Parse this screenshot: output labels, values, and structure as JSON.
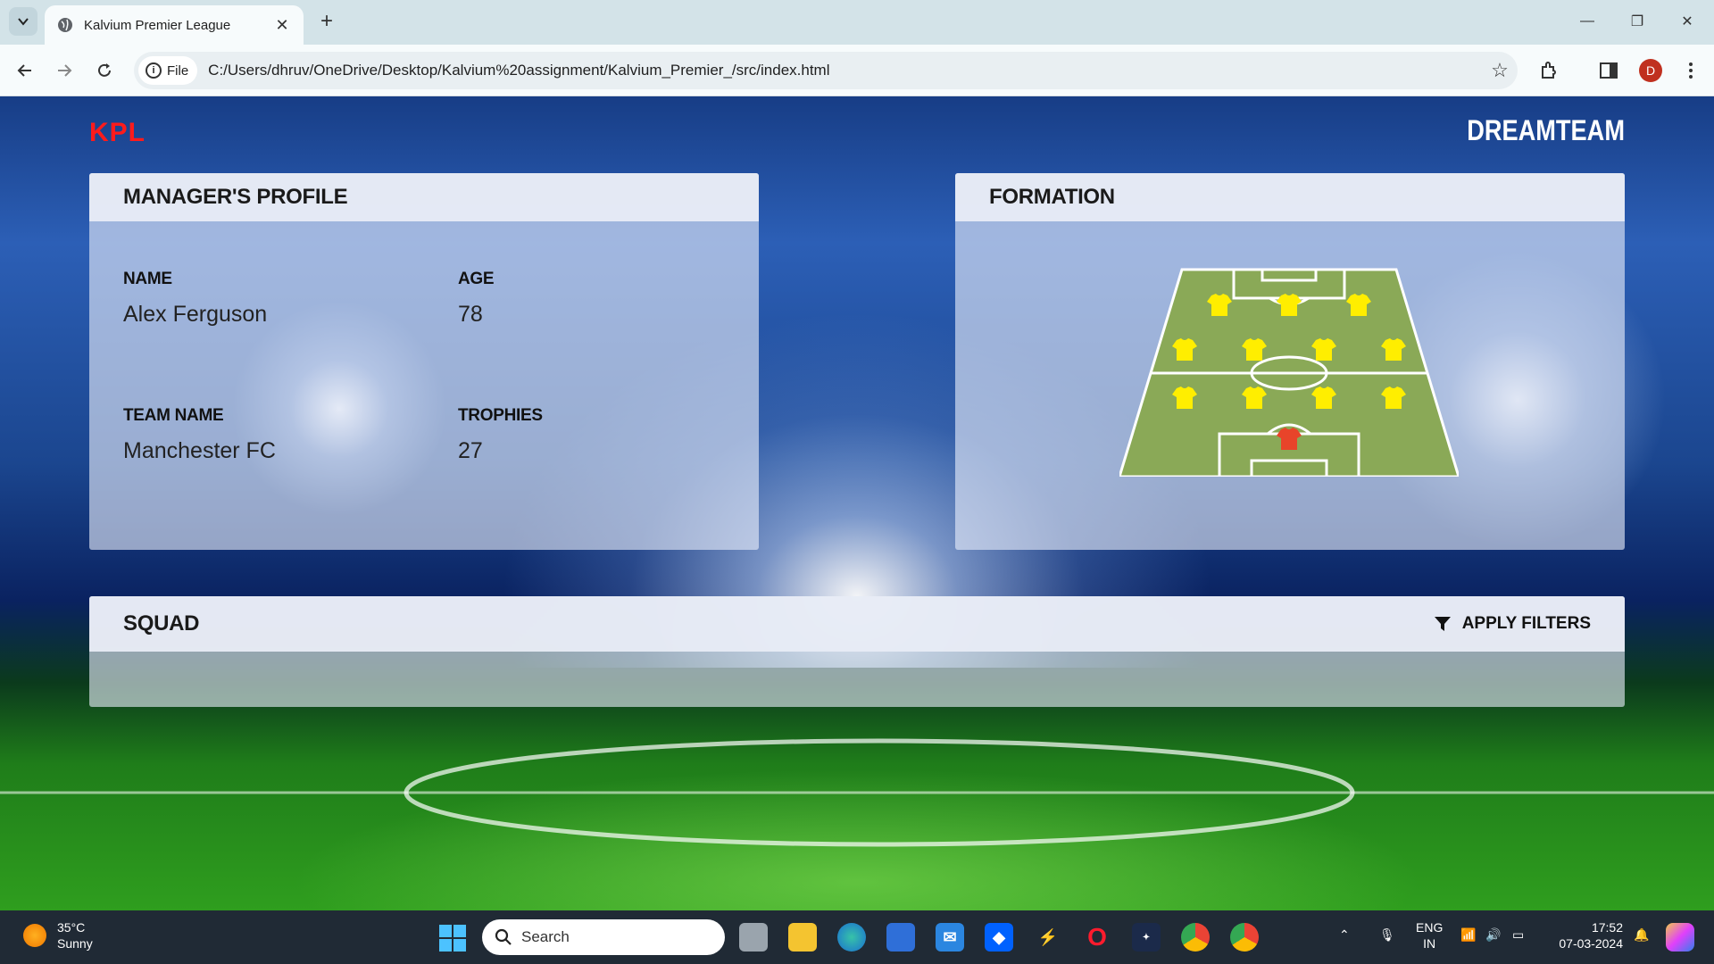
{
  "browser": {
    "tab_title": "Kalvium Premier League",
    "site_chip": "File",
    "url": "C:/Users/dhruv/OneDrive/Desktop/Kalvium%20assignment/Kalvium_Premier_/src/index.html",
    "profile_initial": "D"
  },
  "header": {
    "brand_left": "KPL",
    "brand_right": "DREAMTEAM"
  },
  "manager_profile": {
    "title": "MANAGER'S PROFILE",
    "name_label": "NAME",
    "name_value": "Alex Ferguson",
    "age_label": "AGE",
    "age_value": "78",
    "team_label": "TEAM NAME",
    "team_value": "Manchester FC",
    "trophies_label": "TROPHIES",
    "trophies_value": "27"
  },
  "formation": {
    "title": "FORMATION",
    "pitch_color": "#8aa957",
    "outfield_shirt_color": "#ffee00",
    "keeper_shirt_color": "#e8442a"
  },
  "squad": {
    "title": "SQUAD",
    "filter_label": "APPLY FILTERS"
  },
  "taskbar": {
    "temperature": "35°C",
    "weather": "Sunny",
    "search_placeholder": "Search",
    "language": "ENG",
    "region": "IN",
    "time": "17:52",
    "date": "07-03-2024"
  }
}
